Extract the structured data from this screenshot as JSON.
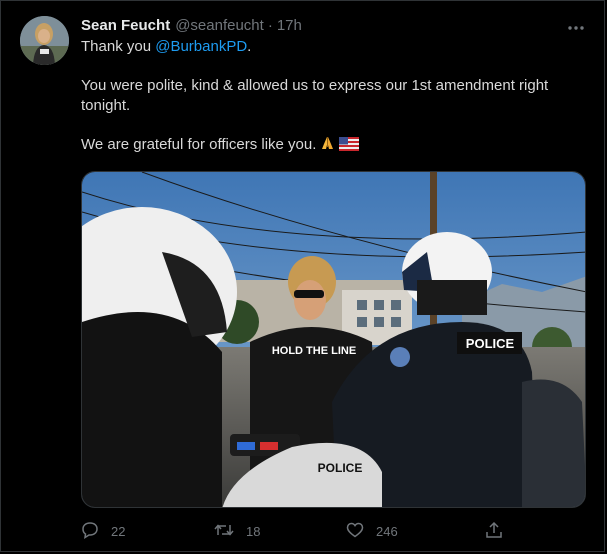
{
  "tweet": {
    "author_name": "Sean Feucht",
    "author_handle": "@seanfeucht",
    "separator": "·",
    "timestamp": "17h",
    "text_line1_prefix": "Thank you ",
    "mention": "@BurbankPD",
    "text_line1_suffix": ".",
    "text_para2": "You were polite, kind & allowed us to express our 1st amendment right tonight.",
    "text_para3": "We are grateful for officers like you."
  },
  "media": {
    "shirt_text": "HOLD THE LINE",
    "helmet_text": "POLICE",
    "vest_text": "POLICE",
    "bike_text": "POLICE"
  },
  "actions": {
    "reply_count": "22",
    "retweet_count": "18",
    "like_count": "246"
  },
  "icons": {
    "more": "more-dots-icon",
    "reply": "reply-icon",
    "retweet": "retweet-icon",
    "like": "heart-icon",
    "share": "share-icon",
    "pray": "folded-hands-emoji",
    "flag": "us-flag-emoji"
  },
  "colors": {
    "background": "#000000",
    "text": "#d9d9d9",
    "muted": "#71767b",
    "link": "#1d9bf0"
  }
}
